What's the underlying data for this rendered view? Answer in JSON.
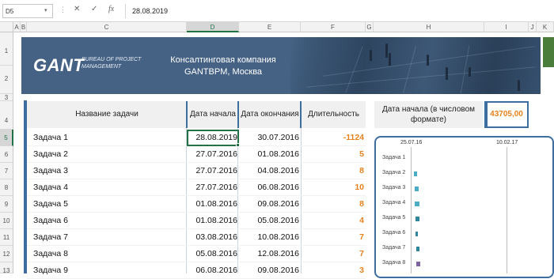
{
  "formula_bar": {
    "cell_ref": "D5",
    "cancel_glyph": "✕",
    "enter_glyph": "✓",
    "fx_glyph": "fx",
    "value": "28.08.2019"
  },
  "columns": [
    "A",
    "B",
    "C",
    "D",
    "E",
    "F",
    "G",
    "H",
    "I",
    "J",
    "K"
  ],
  "rows": [
    "1",
    "2",
    "3",
    "4",
    "5",
    "6",
    "7",
    "8",
    "9",
    "10",
    "11",
    "12",
    "13"
  ],
  "banner": {
    "logo": "GANT",
    "logo_sub": "BUREAU OF PROJECT MANAGEMENT",
    "company_line1": "Консалтинговая компания",
    "company_line2": "GANTBPM, Москва"
  },
  "table": {
    "headers": {
      "name": "Название задачи",
      "start": "Дата начала",
      "end": "Дата окончания",
      "duration": "Длительность"
    },
    "rows": [
      {
        "name": "Задача 1",
        "start": "28.08.2019",
        "end": "30.07.2016",
        "duration": "-1124"
      },
      {
        "name": "Задача 2",
        "start": "27.07.2016",
        "end": "01.08.2016",
        "duration": "5"
      },
      {
        "name": "Задача 3",
        "start": "27.07.2016",
        "end": "04.08.2016",
        "duration": "8"
      },
      {
        "name": "Задача 4",
        "start": "27.07.2016",
        "end": "06.08.2016",
        "duration": "10"
      },
      {
        "name": "Задача 5",
        "start": "01.08.2016",
        "end": "09.08.2016",
        "duration": "8"
      },
      {
        "name": "Задача 6",
        "start": "01.08.2016",
        "end": "05.08.2016",
        "duration": "4"
      },
      {
        "name": "Задача 7",
        "start": "03.08.2016",
        "end": "10.08.2016",
        "duration": "7"
      },
      {
        "name": "Задача 8",
        "start": "05.08.2016",
        "end": "12.08.2016",
        "duration": "7"
      },
      {
        "name": "Задача 9",
        "start": "06.08.2016",
        "end": "09.08.2016",
        "duration": "3"
      }
    ]
  },
  "numeric_start": {
    "label": "Дата начала (в числовом формате)",
    "value": "43705,00"
  },
  "gantt": {
    "ticks": [
      "25.07.16",
      "10.02.17"
    ],
    "labels": [
      "Задача 1",
      "Задача 2",
      "Задача 3",
      "Задача 4",
      "Задача 5",
      "Задача 6",
      "Задача 7",
      "Задача 8"
    ],
    "bar_colors": [
      "",
      "#4bacc6",
      "#4bacc6",
      "#4bacc6",
      "#31859b",
      "#31859b",
      "#31859b",
      "#8064a2"
    ]
  },
  "colors": {
    "accent": "#3d6ea0",
    "banner": "#456284",
    "duration": "#e7811c",
    "excel_green": "#217346"
  }
}
